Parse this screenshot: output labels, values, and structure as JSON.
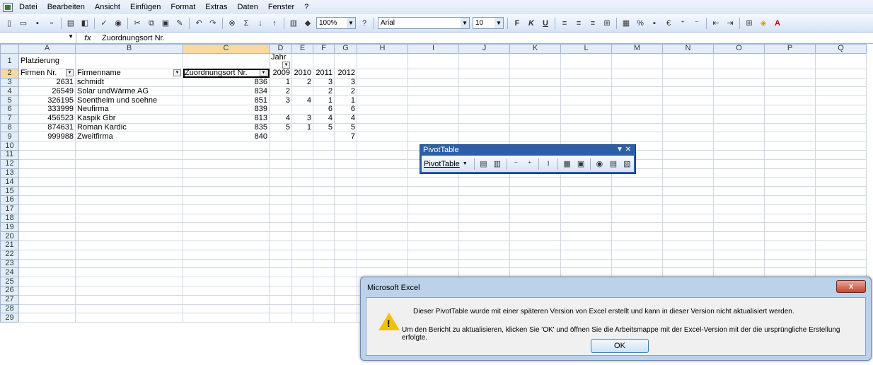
{
  "menu": [
    "Datei",
    "Bearbeiten",
    "Ansicht",
    "Einfügen",
    "Format",
    "Extras",
    "Daten",
    "Fenster",
    "?"
  ],
  "toolbar": {
    "zoom": "100%",
    "font": "Arial",
    "size": "10"
  },
  "formula": {
    "name": "",
    "content": "Zuordnungsort Nr.",
    "fx": "fx"
  },
  "columns": [
    "A",
    "B",
    "C",
    "D",
    "E",
    "F",
    "G",
    "H",
    "I",
    "J",
    "K",
    "L",
    "M",
    "N",
    "O",
    "P",
    "Q"
  ],
  "cells": {
    "A1": "Platzierung",
    "D1": "Jahr",
    "A2": "Firmen Nr.",
    "B2": "Firmenname",
    "C2": "Zuordnungsort Nr.",
    "D2": "2009",
    "E2": "2010",
    "F2": "2011",
    "G2": "2012",
    "A3": "2631",
    "B3": "schmidt",
    "C3": "836",
    "D3": "1",
    "E3": "2",
    "F3": "3",
    "G3": "3",
    "A4": "26549",
    "B4": "Solar undWärme AG",
    "C4": "834",
    "D4": "2",
    "F4": "2",
    "G4": "2",
    "A5": "326195",
    "B5": "Soentheim und soehne",
    "C5": "851",
    "D5": "3",
    "E5": "4",
    "F5": "1",
    "G5": "1",
    "A6": "333999",
    "B6": "Neufirma",
    "C6": "839",
    "F6": "6",
    "G6": "6",
    "A7": "456523",
    "B7": "Kaspik Gbr",
    "C7": "813",
    "D7": "4",
    "E7": "3",
    "F7": "4",
    "G7": "4",
    "A8": "874631",
    "B8": "Roman Kardic",
    "C8": "835",
    "D8": "5",
    "E8": "1",
    "F8": "5",
    "G8": "5",
    "A9": "999988",
    "B9": "Zweitfirma",
    "C9": "840",
    "G9": "7"
  },
  "pivot": {
    "title": "PivotTable",
    "menu": "PivotTable"
  },
  "dialog": {
    "title": "Microsoft Excel",
    "close": "x",
    "message1": "Dieser PivotTable wurde mit einer späteren Version von Excel erstellt und kann in dieser Version nicht aktualisiert werden.",
    "message2": "Um den Bericht zu aktualisieren, klicken Sie 'OK' und öffnen Sie die Arbeitsmappe mit der Excel-Version mit der die ursprüngliche Erstellung erfolgte.",
    "ok": "OK"
  }
}
